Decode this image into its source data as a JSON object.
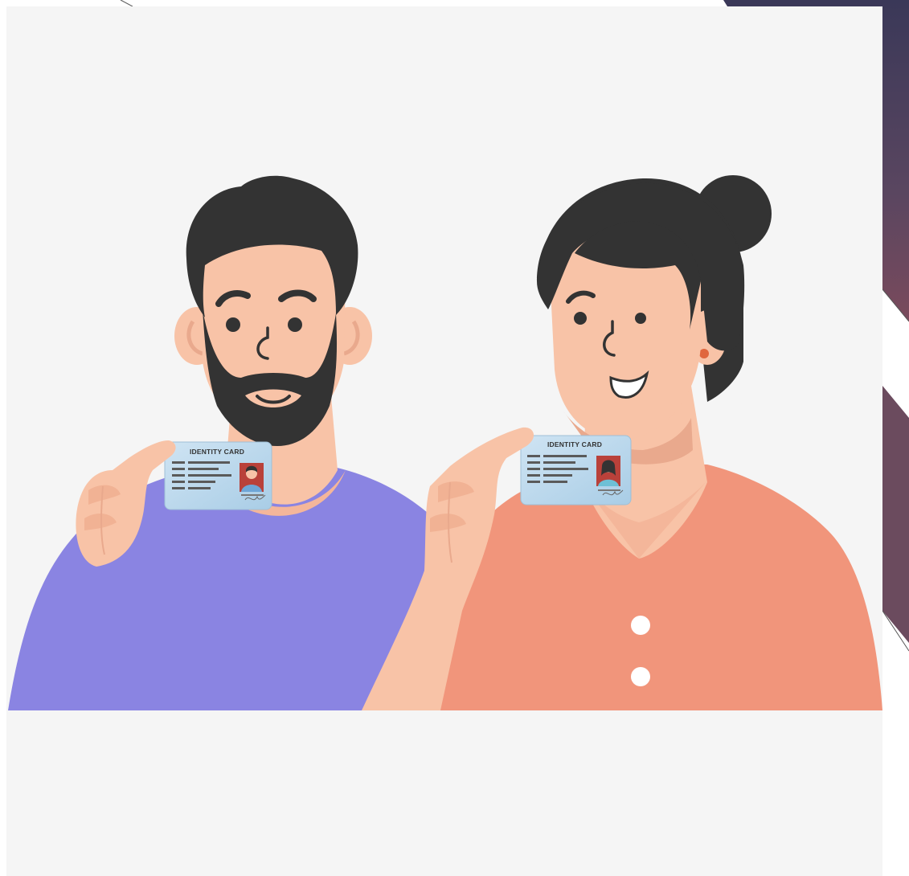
{
  "illustration": {
    "card_left": {
      "label": "IDENTITY CARD"
    },
    "card_right": {
      "label": "IDENTITY CARD"
    }
  },
  "colors": {
    "panel_background": "#f5f5f5",
    "frame_dark": "#3c3a5a",
    "frame_accent": "#6e4a5e",
    "hair": "#333333",
    "skin": "#f8c3a7",
    "skin_shadow": "#e9a98d",
    "man_shirt": "#8a84e2",
    "woman_shirt": "#f1957b",
    "card_blue": "#b6d5ea",
    "card_text_lines": "#5a5a5a",
    "earring": "#e0673e"
  }
}
